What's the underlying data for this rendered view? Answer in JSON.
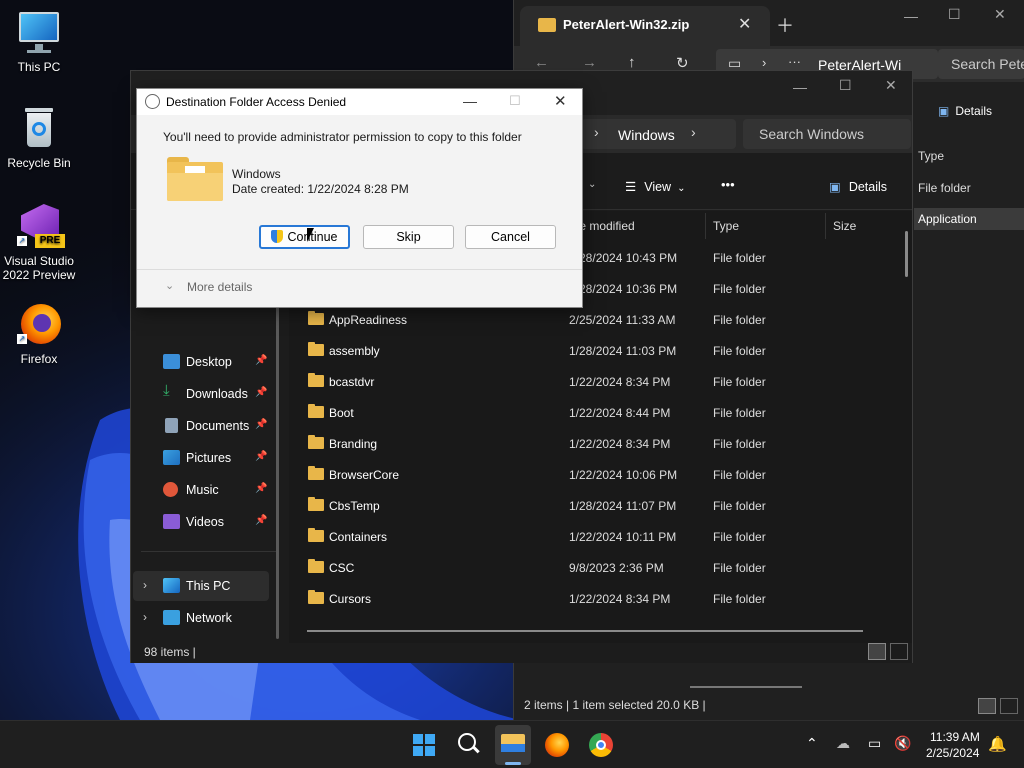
{
  "desktop": {
    "icons": [
      {
        "label": "This PC",
        "icon": "monitor-icon"
      },
      {
        "label": "Recycle Bin",
        "icon": "recycle-bin-icon"
      },
      {
        "label": "Visual Studio 2022 Preview",
        "badge": "PRE",
        "icon": "visual-studio-icon"
      },
      {
        "label": "Firefox",
        "icon": "firefox-icon"
      }
    ]
  },
  "zip_window": {
    "tab_title": "PeterAlert-Win32.zip",
    "address": "PeterAlert-Wi",
    "search_placeholder": "Search Pete",
    "details_label": "Details",
    "columns": {
      "type": "Type",
      "row1": "File folder",
      "row2": "Application"
    },
    "status": "2 items  |  1 item selected  20.0 KB  |"
  },
  "explorer": {
    "breadcrumb": "Windows",
    "search_placeholder": "Search Windows",
    "toolbar": {
      "view": "View",
      "more": "•••",
      "details": "Details"
    },
    "columns": {
      "date": "te modified",
      "type": "Type",
      "size": "Size"
    },
    "sidebar": [
      {
        "label": "Desktop",
        "pinned": true,
        "color": "#3b8fd9"
      },
      {
        "label": "Downloads",
        "pinned": true,
        "color": "#33b36b"
      },
      {
        "label": "Documents",
        "pinned": true,
        "color": "#8fa3b8"
      },
      {
        "label": "Pictures",
        "pinned": true,
        "color": "#3aa0e0"
      },
      {
        "label": "Music",
        "pinned": true,
        "color": "#e0573a"
      },
      {
        "label": "Videos",
        "pinned": true,
        "color": "#8a5cd6"
      },
      {
        "label": "This PC",
        "pinned": false,
        "color": "#3aa0e0"
      },
      {
        "label": "Network",
        "pinned": false,
        "color": "#3aa0e0"
      }
    ],
    "files": [
      {
        "name": "",
        "date": "8/28/2024 10:43 PM",
        "type": "File folder"
      },
      {
        "name": "",
        "date": "8/28/2024 10:36 PM",
        "type": "File folder"
      },
      {
        "name": "AppReadiness",
        "date": "2/25/2024 11:33 AM",
        "type": "File folder"
      },
      {
        "name": "assembly",
        "date": "1/28/2024 11:03 PM",
        "type": "File folder"
      },
      {
        "name": "bcastdvr",
        "date": "1/22/2024 8:34 PM",
        "type": "File folder"
      },
      {
        "name": "Boot",
        "date": "1/22/2024 8:44 PM",
        "type": "File folder"
      },
      {
        "name": "Branding",
        "date": "1/22/2024 8:34 PM",
        "type": "File folder"
      },
      {
        "name": "BrowserCore",
        "date": "1/22/2024 10:06 PM",
        "type": "File folder"
      },
      {
        "name": "CbsTemp",
        "date": "1/28/2024 11:07 PM",
        "type": "File folder"
      },
      {
        "name": "Containers",
        "date": "1/22/2024 10:11 PM",
        "type": "File folder"
      },
      {
        "name": "CSC",
        "date": "9/8/2023 2:36 PM",
        "type": "File folder"
      },
      {
        "name": "Cursors",
        "date": "1/22/2024 8:34 PM",
        "type": "File folder"
      }
    ],
    "status": "98 items  |"
  },
  "dialog": {
    "title": "Destination Folder Access Denied",
    "message": "You'll need to provide administrator permission to copy to this folder",
    "folder_name": "Windows",
    "folder_date": "Date created: 1/22/2024 8:28 PM",
    "buttons": {
      "continue": "Continue",
      "skip": "Skip",
      "cancel": "Cancel"
    },
    "more_details": "More details"
  },
  "taskbar": {
    "time": "11:39 AM",
    "date": "2/25/2024"
  },
  "colors": {
    "accent": "#2878d6",
    "folder": "#e8b649"
  }
}
